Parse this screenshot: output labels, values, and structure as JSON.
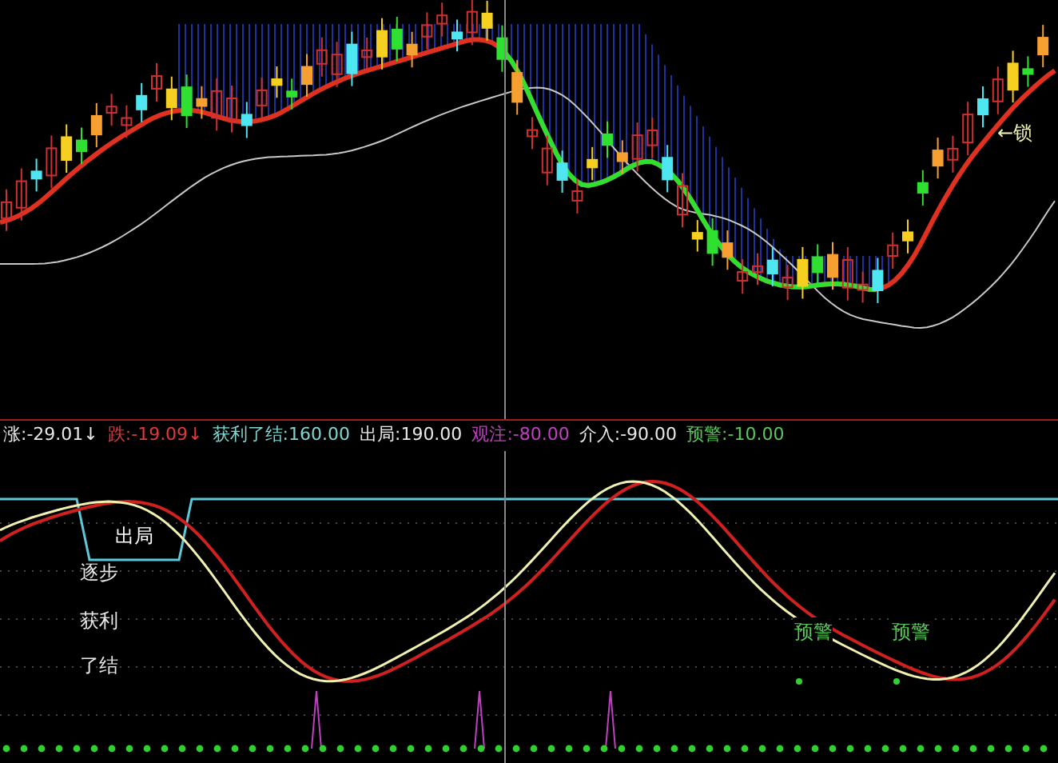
{
  "price_panel": {
    "marker_label": "←锁"
  },
  "legend": [
    {
      "text": "涨:-29.01↓",
      "color": "#e8e8e8"
    },
    {
      "text": "跌:-19.09↓",
      "color": "#e03a3a"
    },
    {
      "text": "获利了结:160.00",
      "color": "#7fd6d0"
    },
    {
      "text": "出局:190.00",
      "color": "#e8e8e8"
    },
    {
      "text": "观注:-80.00",
      "color": "#c040c0"
    },
    {
      "text": "介入:-90.00",
      "color": "#e8e8e8"
    },
    {
      "text": "预警:-10.00",
      "color": "#58c858"
    }
  ],
  "indicator_panel": {
    "exit_label": "出局",
    "zone_labels": [
      "逐步",
      "获利",
      "了结"
    ],
    "signals": [
      {
        "label": "预警"
      },
      {
        "label": "预警"
      }
    ]
  }
}
